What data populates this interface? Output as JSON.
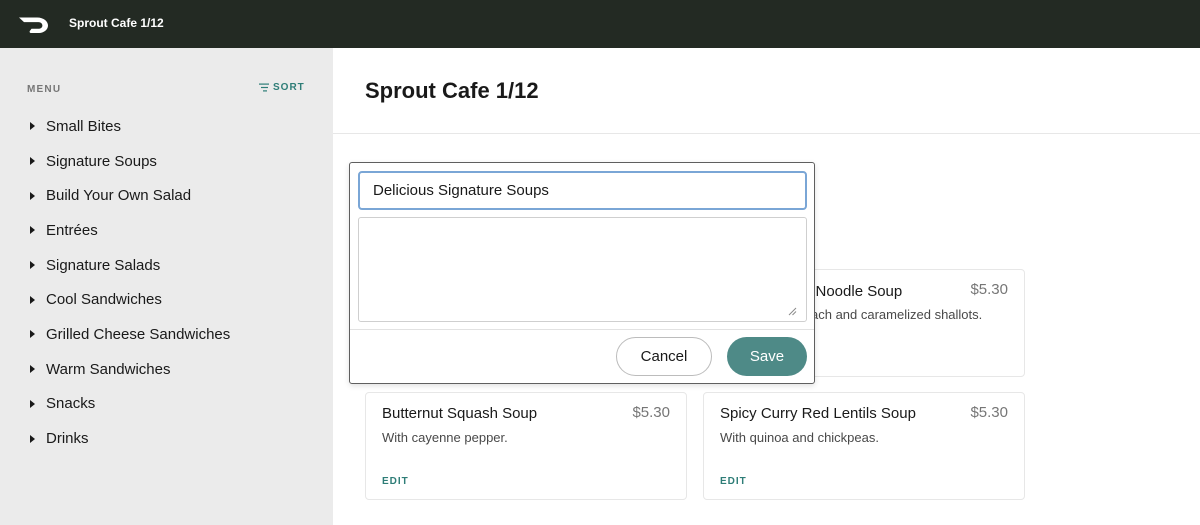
{
  "header": {
    "logo_icon": "doordash-logo-icon",
    "store_name": "Sprout Cafe 1/12"
  },
  "sidebar": {
    "menu_label": "MENU",
    "sort_label": "SORT",
    "sort_icon": "sort-lines-icon",
    "categories": [
      {
        "label": "Small Bites"
      },
      {
        "label": "Signature Soups"
      },
      {
        "label": "Build Your Own Salad"
      },
      {
        "label": "Entrées"
      },
      {
        "label": "Signature Salads"
      },
      {
        "label": "Cool Sandwiches"
      },
      {
        "label": "Grilled Cheese Sandwiches"
      },
      {
        "label": "Warm Sandwiches"
      },
      {
        "label": "Snacks"
      },
      {
        "label": "Drinks"
      }
    ]
  },
  "main": {
    "title": "Sprout Cafe 1/12",
    "items": [
      {
        "name": "Noodle Soup",
        "name_visible": "n Noodle Soup",
        "price": "$5.30",
        "description": "ach and caramelized shallots."
      },
      {
        "name": "Butternut Squash Soup",
        "price": "$5.30",
        "description": "With cayenne pepper.",
        "edit_label": "EDIT"
      },
      {
        "name": "Spicy Curry Red Lentils Soup",
        "price": "$5.30",
        "description": "With quinoa and chickpeas.",
        "edit_label": "EDIT"
      }
    ]
  },
  "edit_popover": {
    "name_value": "Delicious Signature Soups",
    "description_value": "",
    "cancel_label": "Cancel",
    "save_label": "Save"
  },
  "colors": {
    "topbar": "#232a23",
    "sidebar": "#ebebeb",
    "accent": "#2e7d77",
    "save_button": "#4e8a87",
    "input_focus": "#7aa6d6"
  }
}
